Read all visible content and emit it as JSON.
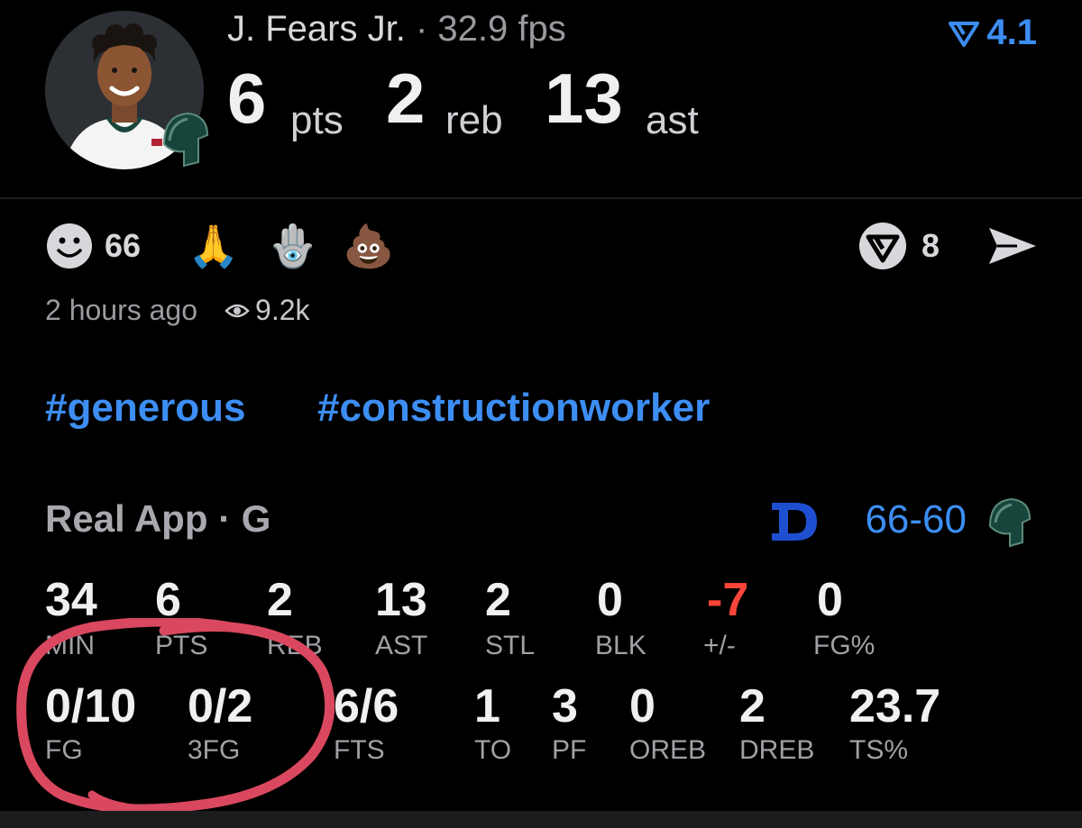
{
  "header": {
    "player_name": "J. Fears Jr.",
    "separator": "·",
    "fps": "32.9 fps",
    "rating": "4.1",
    "pts_value": "6",
    "pts_label": "pts",
    "reb_value": "2",
    "reb_label": "reb",
    "ast_value": "13",
    "ast_label": "ast"
  },
  "reactions": {
    "smile_count": "66",
    "share_count": "8",
    "icons": [
      "smile-icon",
      "praying-hands-emoji",
      "hamsa-emoji",
      "poop-emoji",
      "real-logo-icon",
      "send-icon"
    ]
  },
  "meta": {
    "time": "2 hours ago",
    "views": "9.2k"
  },
  "hashtags": [
    "#generous",
    "#constructionworker"
  ],
  "game": {
    "source": "Real App · G",
    "score_team": "66",
    "score_sep": "-",
    "score_opp": "60"
  },
  "stats_row1": [
    {
      "value": "34",
      "label": "MIN"
    },
    {
      "value": "6",
      "label": "PTS"
    },
    {
      "value": "2",
      "label": "REB"
    },
    {
      "value": "13",
      "label": "AST"
    },
    {
      "value": "2",
      "label": "STL"
    },
    {
      "value": "0",
      "label": "BLK"
    },
    {
      "value": "-7",
      "label": "+/-"
    },
    {
      "value": "0",
      "label": "FG%"
    }
  ],
  "stats_row2": [
    {
      "value": "0/10",
      "label": "FG"
    },
    {
      "value": "0/2",
      "label": "3FG"
    },
    {
      "value": "6/6",
      "label": "FTS"
    },
    {
      "value": "1",
      "label": "TO"
    },
    {
      "value": "3",
      "label": "PF"
    },
    {
      "value": "0",
      "label": "OREB"
    },
    {
      "value": "2",
      "label": "DREB"
    },
    {
      "value": "23.7",
      "label": "TS%"
    }
  ],
  "colors": {
    "background": "#000000",
    "accent_blue": "#3d8ef3",
    "negative_red": "#ff453a",
    "annotation_circle": "#d9485f",
    "spartan_green": "#18453b"
  }
}
